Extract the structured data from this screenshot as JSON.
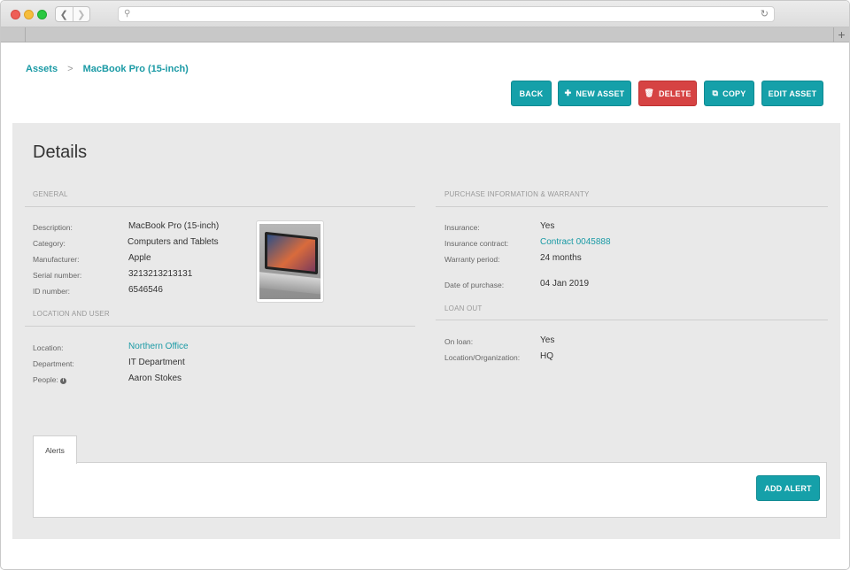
{
  "breadcrumb": {
    "root": "Assets",
    "separator": ">",
    "current": "MacBook Pro (15-inch)"
  },
  "toolbar": {
    "back": "BACK",
    "new_asset": "NEW ASSET",
    "delete": "DELETE",
    "copy": "COPY",
    "edit_asset": "EDIT ASSET"
  },
  "details": {
    "title": "Details",
    "general": {
      "heading": "GENERAL",
      "description_label": "Description:",
      "description": "MacBook Pro (15-inch)",
      "category_label": "Category:",
      "category": "Computers and Tablets",
      "manufacturer_label": "Manufacturer:",
      "manufacturer": "Apple",
      "serial_label": "Serial number:",
      "serial": "3213213213131",
      "id_label": "ID number:",
      "id": "6546546"
    },
    "location": {
      "heading": "LOCATION AND USER",
      "location_label": "Location:",
      "location": "Northern Office",
      "department_label": "Department:",
      "department": "IT Department",
      "people_label": "People:",
      "people": "Aaron Stokes"
    },
    "purchase": {
      "heading": "PURCHASE INFORMATION & WARRANTY",
      "insurance_label": "Insurance:",
      "insurance": "Yes",
      "contract_label": "Insurance contract:",
      "contract": "Contract 0045888",
      "warranty_label": "Warranty period:",
      "warranty": "24 months",
      "date_label": "Date of purchase:",
      "date": "04 Jan 2019"
    },
    "loan": {
      "heading": "LOAN OUT",
      "onloan_label": "On loan:",
      "onloan": "Yes",
      "org_label": "Location/Organization:",
      "org": "HQ"
    }
  },
  "alerts": {
    "tab_label": "Alerts",
    "add_button": "ADD ALERT"
  },
  "colors": {
    "accent": "#15a0a9",
    "danger": "#d64343",
    "link": "#1a9aa5"
  }
}
